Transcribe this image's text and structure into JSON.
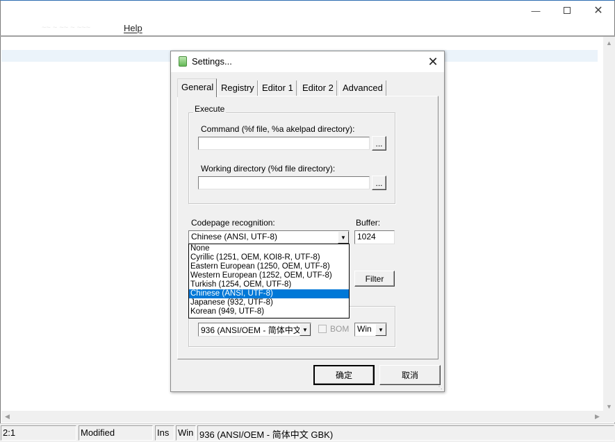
{
  "window": {
    "menu_blur": "~~ ~ ~~ ~ ~~~",
    "help_menu": "Help",
    "minimize_icon": "minimize-icon",
    "maximize_icon": "maximize-icon",
    "close_icon": "close-icon"
  },
  "status": {
    "position": "2:1",
    "modified": "Modified",
    "insert": "Ins",
    "newline": "Win",
    "codepage": "936   (ANSI/OEM - 简体中文 GBK)"
  },
  "dialog": {
    "title": "Settings...",
    "tabs": [
      "General",
      "Registry",
      "Editor 1",
      "Editor 2",
      "Advanced"
    ],
    "execute": {
      "group_title": "Execute",
      "command_label": "Command (%f file, %a akelpad directory):",
      "command_value": "",
      "command_browse": "...",
      "workdir_label": "Working directory (%d file directory):",
      "workdir_value": "",
      "workdir_browse": "..."
    },
    "codepage": {
      "label": "Codepage recognition:",
      "selected": "Chinese (ANSI, UTF-8)",
      "options": [
        "None",
        "Cyrillic (1251, OEM, KOI8-R, UTF-8)",
        "Eastern European (1250, OEM, UTF-8)",
        "Western European (1252, OEM, UTF-8)",
        "Turkish (1254, OEM, UTF-8)",
        "Chinese (ANSI, UTF-8)",
        "Japanese (932, UTF-8)",
        "Korean (949, UTF-8)"
      ],
      "selected_index": 5
    },
    "buffer": {
      "label": "Buffer:",
      "value": "1024"
    },
    "filter_button": "Filter",
    "default_codepage": {
      "value": "936  (ANSI/OEM - 简体中文",
      "bom_label": "BOM",
      "newline_value": "Win"
    },
    "ok_button": "确定",
    "cancel_button": "取消"
  }
}
